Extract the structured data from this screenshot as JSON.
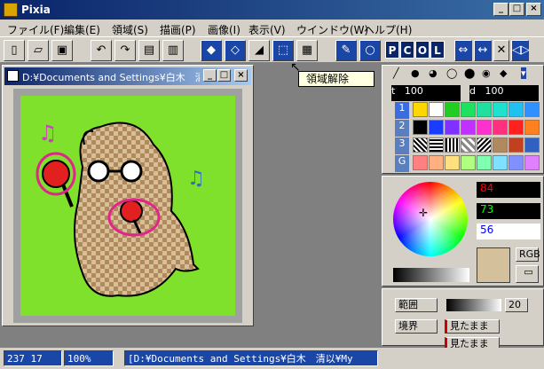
{
  "window": {
    "title": "Pixia"
  },
  "menu": [
    "ファイル(F)",
    "編集(E)",
    "領域(S)",
    "描画(P)",
    "画像(I)",
    "表示(V)",
    "ウインドウ(W)",
    "ヘルプ(H)"
  ],
  "toolbar": {
    "pcol": [
      "P",
      "C",
      "O",
      "L"
    ]
  },
  "tooltip": "領域解除",
  "document": {
    "title": "D:¥Documents and Settings¥白木　清…"
  },
  "brush": {
    "size_label": "t",
    "size_value": "100",
    "density_label": "d",
    "density_value": "100"
  },
  "palette_rows": [
    "1",
    "2",
    "3",
    "G"
  ],
  "color_values": {
    "r": "84",
    "g": "73",
    "b": "56"
  },
  "color_labels": {
    "rgb": "RGB"
  },
  "colors": {
    "accent": "#0a246a",
    "canvas_bg": "#7fe12b",
    "current_color": "#d4c09a"
  },
  "options": {
    "range_label": "範囲",
    "range_value": "20",
    "border_label": "境界",
    "border_value1": "見たまま",
    "border_value2": "見たまま"
  },
  "status": {
    "coords": "237 17",
    "zoom": "100%",
    "path": "[D:¥Documents and Settings¥白木　清以¥My"
  }
}
